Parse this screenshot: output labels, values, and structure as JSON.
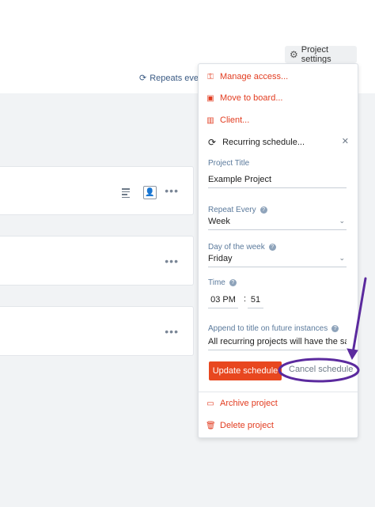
{
  "header": {
    "project_settings_label": "Project settings",
    "gear_icon": "gear-icon",
    "repeats_label": "Repeats ever"
  },
  "cards": [
    {
      "dots": "•••"
    },
    {
      "dots": "•••"
    },
    {
      "dots": "•••"
    }
  ],
  "menu": {
    "manage_access": "Manage access...",
    "move_to_board": "Move to board...",
    "client": "Client...",
    "recurring_title": "Recurring schedule...",
    "close_symbol": "✕",
    "fields": {
      "project_title_label": "Project Title",
      "project_title_value": "Example Project",
      "repeat_every_label": "Repeat Every",
      "repeat_every_value": "Week",
      "day_label": "Day of the week",
      "day_value": "Friday",
      "time_label": "Time",
      "time_hour": "03 PM",
      "time_sep": ":",
      "time_minute": "51",
      "append_label": "Append to title on future instances",
      "append_value": "All recurring projects will have the sa"
    },
    "update_button": "Update schedule",
    "cancel_button": "Cancel schedule",
    "archive": "Archive project",
    "delete": "Delete project"
  },
  "colors": {
    "accent": "#e8471f",
    "menu_red": "#e23c20",
    "label_blue": "#5b7a9c",
    "annotation_purple": "#5b2a9e"
  }
}
